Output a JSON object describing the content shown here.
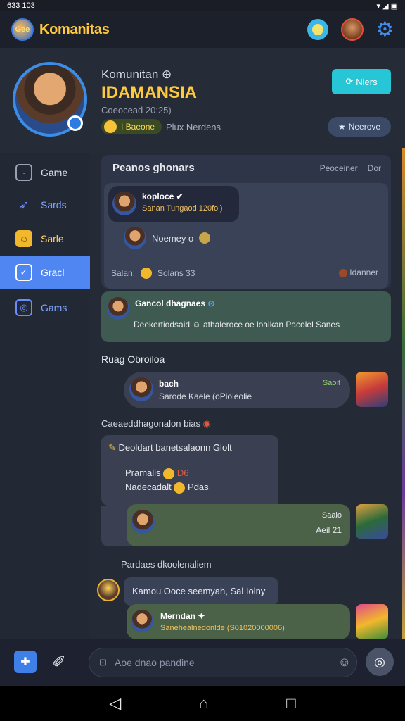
{
  "status": {
    "time": "633 103",
    "icons": "▾ ◢ ▣"
  },
  "app": {
    "logo_text": "Gee",
    "name": "Komanitas"
  },
  "profile": {
    "title": "Komunitan ⊕",
    "name": "IDAMANSIA",
    "subtitle": "Coeocead 20:25)",
    "chip": "I Baeone",
    "members": "Plux Nerdens",
    "news_btn": "Niers",
    "remove_btn": "Neerove"
  },
  "sidebar": {
    "items": [
      {
        "label": "Game",
        "icon": "game-icon"
      },
      {
        "label": "Sards",
        "icon": "rocket-icon"
      },
      {
        "label": "Sarle",
        "icon": "trophy-icon"
      },
      {
        "label": "Gracl",
        "icon": "check-icon"
      },
      {
        "label": "Gams",
        "icon": "target-icon"
      }
    ]
  },
  "feed": {
    "card1": {
      "heading": "Peanos ghonars",
      "meta_left": "Peoceiner",
      "meta_right": "Dor",
      "msg_name": "koploce ✔",
      "msg_text": "Sanan Tungaod 120fol)",
      "row_b": "Noemey o",
      "row_c_left": "Salan;",
      "row_c_mid": "Solans  33",
      "row_c_right": "Idanner"
    },
    "card2": {
      "name": "Gancol dhagnaes",
      "text": "Deekertiodsaid ☺ athaleroce oe loalkan Pacolel Sanes"
    },
    "section1": "Ruag Obroiloa",
    "msg1": {
      "name": "bach",
      "text": "Sarode Kaele (oPioleolie",
      "time": "Saoit"
    },
    "section2": "Caeaeddhagonalon bias",
    "card3": {
      "l1": "Deoldart  banetsalaonn Glolt",
      "l2": "Pramalis",
      "l2b": "D6",
      "l3": "Nadecadalt",
      "l3b": "Pdas",
      "time": "Saaio",
      "reply": "Aeil 21"
    },
    "section3": "Pardaes dkoolenaliem",
    "pill4": "Kamou Ooce seemyah, Sal Iolny",
    "pill5": {
      "name": "Merndan ✦",
      "text": "Sanehealnedonlde (S01020000006)"
    }
  },
  "composer": {
    "placeholder": "Aoe dnao pandine",
    "prefix": "⊡"
  }
}
